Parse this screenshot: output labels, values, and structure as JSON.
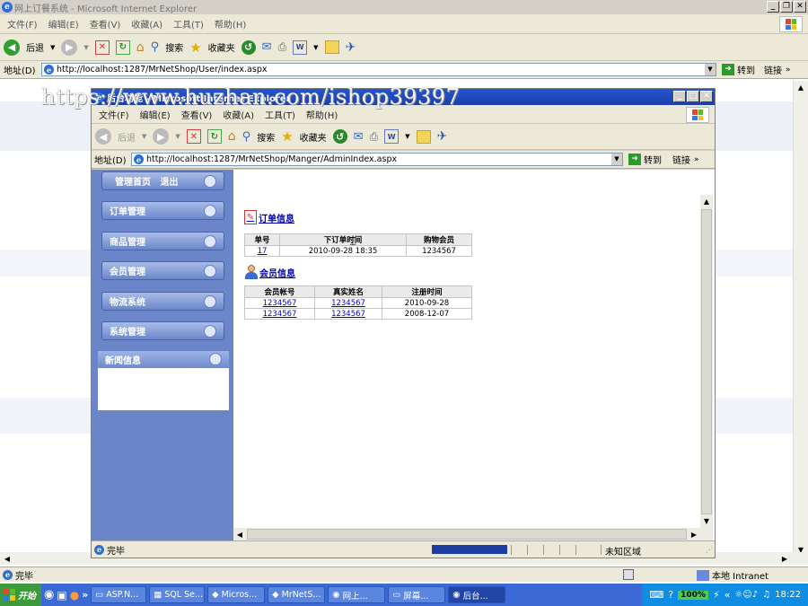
{
  "outer": {
    "title": "网上订餐系统 - Microsoft Internet Explorer",
    "menu": [
      "文件(F)",
      "编辑(E)",
      "查看(V)",
      "收藏(A)",
      "工具(T)",
      "帮助(H)"
    ],
    "toolbar": {
      "back": "后退",
      "search": "搜索",
      "favorites": "收藏夹"
    },
    "address_label": "地址(D)",
    "address": "http://localhost:1287/MrNetShop/User/index.aspx",
    "go": "转到",
    "links": "链接",
    "status": "完毕",
    "zone": "本地 Intranet"
  },
  "watermark": "https://www.huzhan.com/ishop39397",
  "inner": {
    "title": "后台功能 - Microsoft Internet Explorer",
    "menu": [
      "文件(F)",
      "编辑(E)",
      "查看(V)",
      "收藏(A)",
      "工具(T)",
      "帮助(H)"
    ],
    "toolbar": {
      "back": "后退",
      "search": "搜索",
      "favorites": "收藏夹"
    },
    "address_label": "地址(D)",
    "address": "http://localhost:1287/MrNetShop/Manger/AdminIndex.aspx",
    "go": "转到",
    "links": "链接",
    "status": "完毕",
    "zone": "未知区域"
  },
  "sidebar": {
    "top": "管理首页   退出",
    "items": [
      "订单管理",
      "商品管理",
      "会员管理",
      "物流系统",
      "系统管理"
    ],
    "news": "新闻信息"
  },
  "orders": {
    "title": "订单信息",
    "headers": [
      "单号",
      "下订单时间",
      "购物会员"
    ],
    "rows": [
      [
        "17",
        "2010-09-28 18:35",
        "1234567"
      ]
    ]
  },
  "members": {
    "title": "会员信息",
    "headers": [
      "会员帐号",
      "真实姓名",
      "注册时间"
    ],
    "rows": [
      [
        "1234567",
        "1234567",
        "2010-09-28"
      ],
      [
        "1234567",
        "1234567",
        "2008-12-07"
      ]
    ]
  },
  "taskbar": {
    "start": "开始",
    "tasks": [
      "ASP.N...",
      "SQL Se...",
      "Micros...",
      "MrNetS...",
      "网上...",
      "屏幕...",
      "后台..."
    ],
    "zoom": "100%",
    "clock": "18:22"
  },
  "colors": {
    "sidebar": "#6b86c8",
    "titlebar": "#2455d0",
    "taskbar": "#3b6ad6",
    "link": "#0000cc"
  }
}
